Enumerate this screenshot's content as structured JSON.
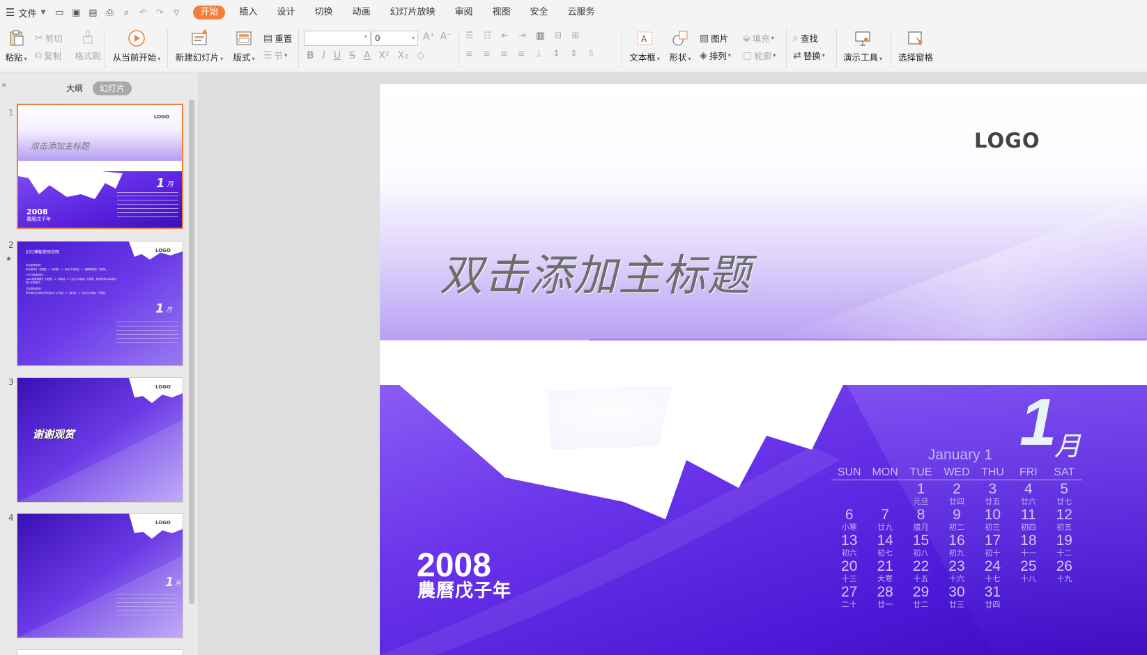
{
  "menubar": {
    "file_label": "文件",
    "tabs": [
      "开始",
      "插入",
      "设计",
      "切换",
      "动画",
      "幻灯片放映",
      "审阅",
      "视图",
      "安全",
      "云服务"
    ],
    "active_tab": "开始"
  },
  "ribbon": {
    "paste": "粘贴",
    "cut": "剪切",
    "copy": "复制",
    "format_painter": "格式刷",
    "from_current": "从当前开始",
    "new_slide": "新建幻灯片",
    "layout": "版式",
    "reset": "重置",
    "section": "节",
    "font_size": "0",
    "textbox": "文本框",
    "shape": "形状",
    "picture": "图片",
    "fill": "填充",
    "arrange": "排列",
    "outline": "轮廓",
    "find": "查找",
    "replace": "替换",
    "presenter_tools": "演示工具",
    "selection_pane": "选择窗格"
  },
  "leftpanel": {
    "tab_outline": "大纲",
    "tab_slides": "幻灯片",
    "slide_numbers": [
      "1",
      "2",
      "3",
      "4"
    ],
    "thumb2": {
      "title": "幻灯模板使用说明",
      "lines": [
        "标志更换说明：",
        "标志更换于【视图】->【母版】->【幻灯片母版】->【编辑母版】下更换。",
        "LOGO更换说明：",
        "Logo更换需要在【视图】->【母版】->【幻灯片母版】下更换，更换时需Logo图片",
        "插入到母版中。",
        "文本更改说明：",
        "所有版式文本框中的内容可【开始】->【版式】->【幻灯片母版】下更换。"
      ]
    },
    "thumb3_text": "谢谢观赏"
  },
  "slide": {
    "logo": "LOGO",
    "title": "双击添加主标题",
    "big_one": "1",
    "month_char": "月",
    "calendar_caption": "January 1",
    "weekdays": [
      "SUN",
      "MON",
      "TUE",
      "WED",
      "THU",
      "FRI",
      "SAT"
    ],
    "weeks": [
      [
        [
          "",
          ""
        ],
        [
          "",
          ""
        ],
        [
          "1",
          "元旦"
        ],
        [
          "2",
          "廿四"
        ],
        [
          "3",
          "廿五"
        ],
        [
          "4",
          "廿六"
        ],
        [
          "5",
          "廿七"
        ]
      ],
      [
        [
          "6",
          "小寒"
        ],
        [
          "7",
          "廿九"
        ],
        [
          "8",
          "腊月"
        ],
        [
          "9",
          "初二"
        ],
        [
          "10",
          "初三"
        ],
        [
          "11",
          "初四"
        ],
        [
          "12",
          "初五"
        ]
      ],
      [
        [
          "13",
          "初六"
        ],
        [
          "14",
          "初七"
        ],
        [
          "15",
          "初八"
        ],
        [
          "16",
          "初九"
        ],
        [
          "17",
          "初十"
        ],
        [
          "18",
          "十一"
        ],
        [
          "19",
          "十二"
        ]
      ],
      [
        [
          "20",
          "十三"
        ],
        [
          "21",
          "大寒"
        ],
        [
          "22",
          "十五"
        ],
        [
          "23",
          "十六"
        ],
        [
          "24",
          "十七"
        ],
        [
          "25",
          "十八"
        ],
        [
          "26",
          "十九"
        ]
      ],
      [
        [
          "27",
          "二十"
        ],
        [
          "28",
          "廿一"
        ],
        [
          "29",
          "廿二"
        ],
        [
          "30",
          "廿三"
        ],
        [
          "31",
          "廿四"
        ],
        [
          "",
          ""
        ],
        [
          "",
          ""
        ]
      ]
    ],
    "year": "2008",
    "lunar_year": "農曆戊子年"
  },
  "colors": {
    "accent": "#f07f3c",
    "purple_dark": "#3e0fc9",
    "purple_light": "#a07cf0"
  }
}
